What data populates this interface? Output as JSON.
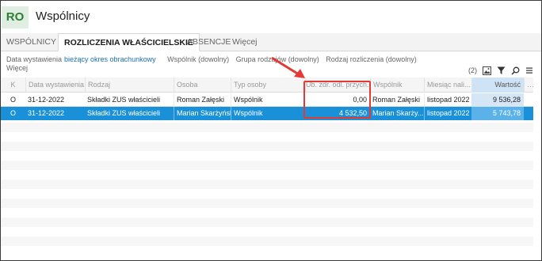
{
  "app": {
    "badge": "RO",
    "title": "Wspólnicy"
  },
  "tabs": [
    {
      "label": "WSPÓLNICY"
    },
    {
      "label": "ROZLICZENIA WŁAŚCICIELSKIE",
      "active": true
    },
    {
      "label": "ABSENCJE"
    },
    {
      "label": "Więcej"
    }
  ],
  "filters": {
    "date_label": "Data wystawienia",
    "date_value": "bieżący okres obrachunkowy",
    "partner": "Wspólnik (dowolny)",
    "group": "Grupa rodzajów (dowolny)",
    "settlement_type": "Rodzaj rozliczenia (dowolny)",
    "more": "Więcej"
  },
  "toolbar": {
    "count": "(2)"
  },
  "columns": [
    "K",
    "Data wystawienia",
    "Rodzaj",
    "Osoba",
    "Typ osoby",
    "Ub. zdr. odl. przych.",
    "Wspólnik",
    "Miesiąc nali...",
    "Wartość"
  ],
  "rows": [
    {
      "k": "O",
      "date": "31-12-2022",
      "type": "Składki ZUS właścicieli",
      "person": "Roman Załęski",
      "person_type": "Wspólnik",
      "health": "0,00",
      "partner": "Roman Załęski",
      "month": "listopad 2022",
      "value": "9 536,28"
    },
    {
      "k": "O",
      "date": "31-12-2022",
      "type": "Składki ZUS właścicieli",
      "person": "Marian Skarżyński",
      "person_type": "Wspólnik",
      "health": "4 532,50",
      "partner": "Marian Skarży...",
      "month": "listopad 2022",
      "value": "5 743,78"
    }
  ],
  "colors": {
    "selection": "#1a90d8",
    "highlight": "#e53935",
    "accent": "#1a6fb0"
  }
}
